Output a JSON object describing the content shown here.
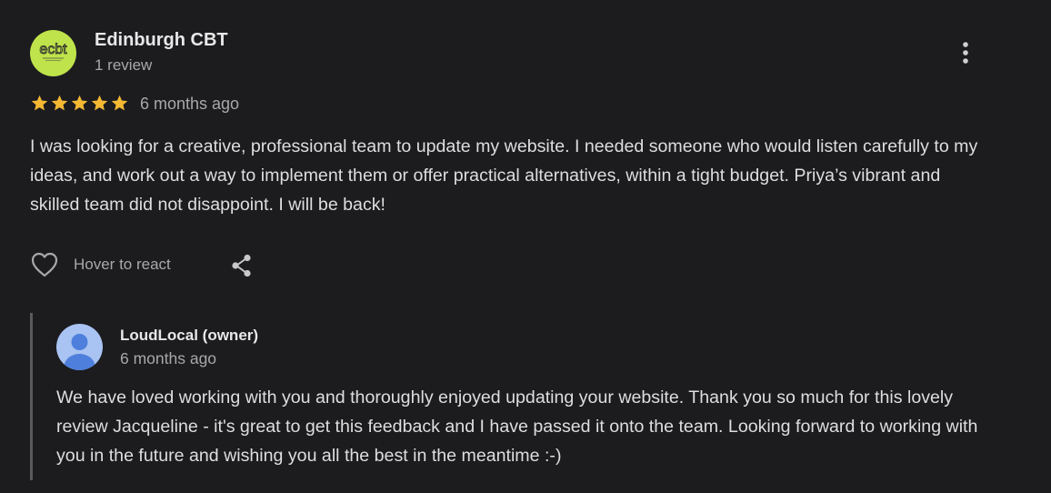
{
  "review": {
    "author": {
      "name": "Edinburgh CBT",
      "meta": "1 review",
      "avatar_logo_text": "ecbt",
      "avatar_color": "#bfe34a"
    },
    "more_options_icon": "three-dots-vertical-icon",
    "rating": 5,
    "rating_max": 5,
    "star_color": "#f5b833",
    "date": "6 months ago",
    "text": "I was looking for a creative, professional team to update my website. I needed someone who would listen carefully to my ideas, and work out a way to implement them or offer practical alternatives, within a tight budget. Priya’s vibrant and skilled team did not disappoint. I will be back!",
    "actions": {
      "react_icon": "heart-outline-icon",
      "react_label": "Hover to react",
      "share_icon": "share-icon"
    }
  },
  "owner_reply": {
    "name": "LoudLocal (owner)",
    "date": "6 months ago",
    "avatar_icon": "default-user-avatar-icon",
    "avatar_color": "#a9c3f2",
    "text": "We have loved working with you and thoroughly enjoyed updating your website. Thank you so much for this lovely review Jacqueline - it's great to get this feedback and I have passed it onto the team. Looking forward to working with you in the future and wishing you all the best in the meantime :-)"
  }
}
